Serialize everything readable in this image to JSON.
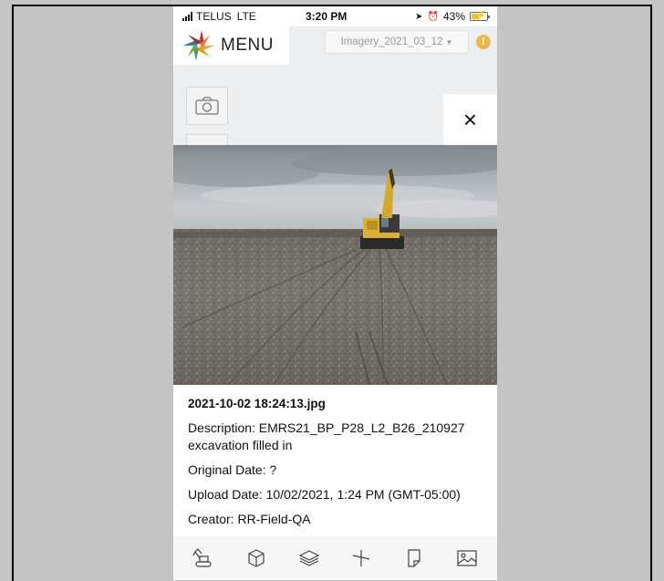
{
  "status_bar": {
    "carrier": "TELUS",
    "network": "LTE",
    "time": "3:20 PM",
    "battery": "43%"
  },
  "app": {
    "menu_label": "MENU",
    "imagery_select": "Imagery_2021_03_12",
    "alert_symbol": "!",
    "close_symbol": "×"
  },
  "photo": {
    "filename": "2021-10-02 18:24:13.jpg",
    "description": "Description: EMRS21_BP_P28_L2_B26_210927 excavation filled in",
    "original_date": "Original Date: ?",
    "upload_date": "Upload Date: 10/02/2021, 1:24 PM (GMT-05:00)",
    "creator": "Creator: RR-Field-QA"
  },
  "toolbar": {
    "items": [
      "excavator-icon",
      "cube-icon",
      "layers-icon",
      "measure-icon",
      "note-icon",
      "image-icon"
    ]
  },
  "colors": {
    "brand_logo": [
      "#c0392b",
      "#e6a33e",
      "#4a9d5b",
      "#2f6fa7"
    ],
    "alert": "#e8b94a",
    "battery_fill": "#f3c22f"
  }
}
